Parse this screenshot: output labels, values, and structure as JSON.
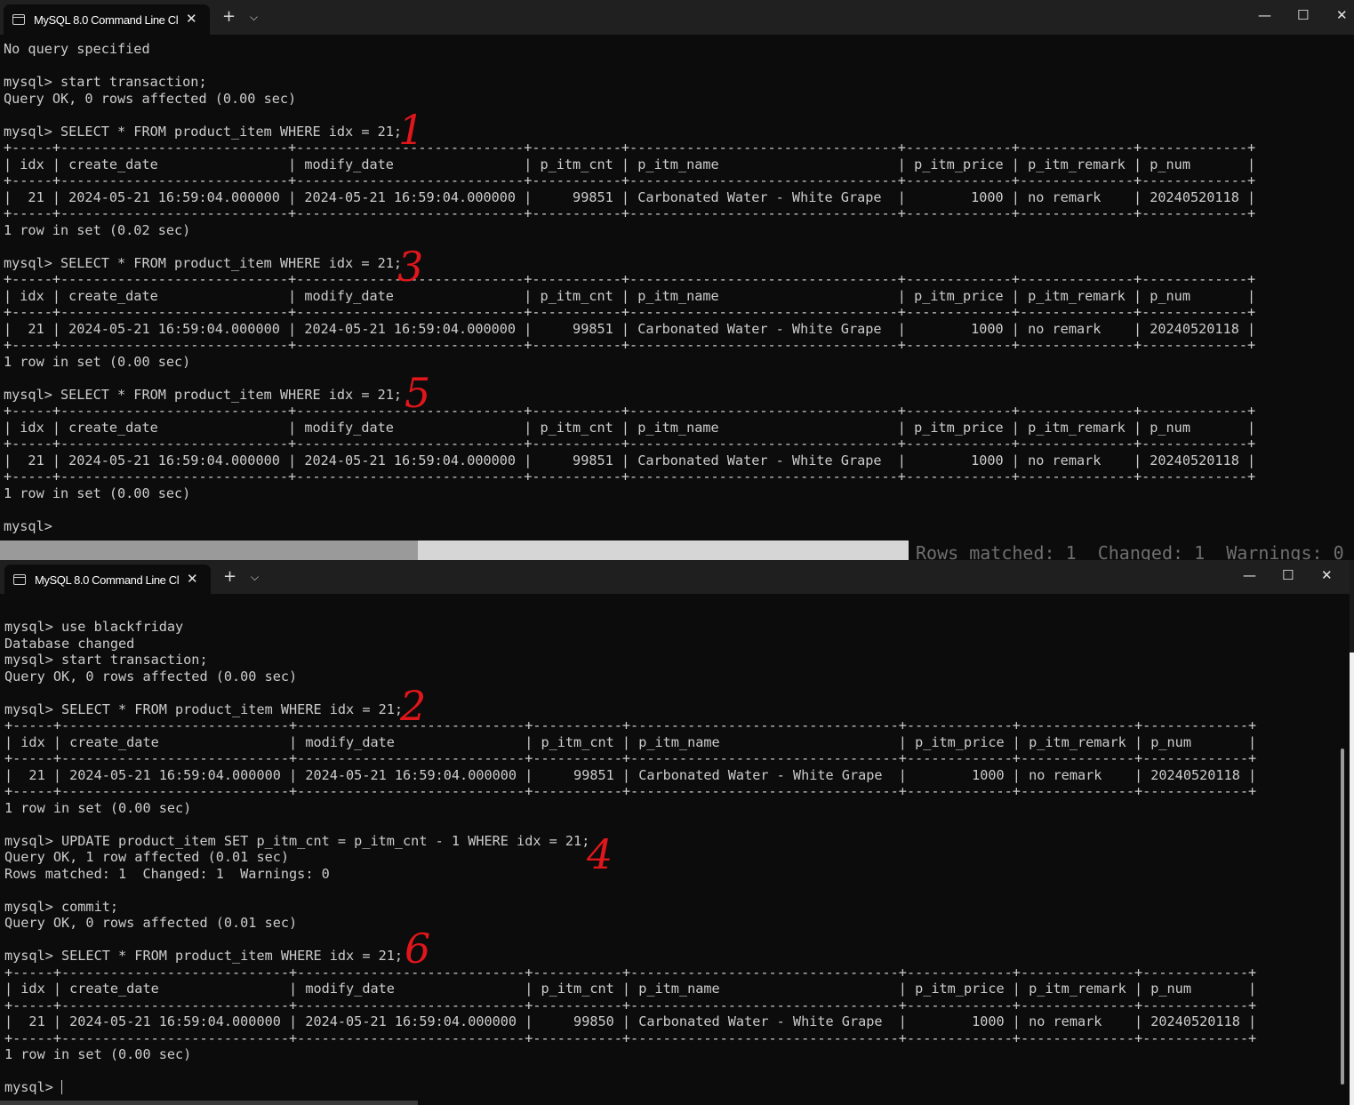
{
  "top_window": {
    "tab_title": "MySQL 8.0 Command Line Client",
    "tab_close": "✕",
    "new_tab": "+",
    "dropdown": "⌵",
    "minimize": "—",
    "maximize": "☐",
    "close": "✕",
    "console_text": "No query specified\n\nmysql> start transaction;\nQuery OK, 0 rows affected (0.00 sec)\n\nmysql> SELECT * FROM product_item WHERE idx = 21;\n+-----+----------------------------+----------------------------+-----------+---------------------------------+-------------+--------------+-------------+\n| idx | create_date                | modify_date                | p_itm_cnt | p_itm_name                      | p_itm_price | p_itm_remark | p_num       |\n+-----+----------------------------+----------------------------+-----------+---------------------------------+-------------+--------------+-------------+\n|  21 | 2024-05-21 16:59:04.000000 | 2024-05-21 16:59:04.000000 |     99851 | Carbonated Water - White Grape  |        1000 | no remark    | 20240520118 |\n+-----+----------------------------+----------------------------+-----------+---------------------------------+-------------+--------------+-------------+\n1 row in set (0.02 sec)\n\nmysql> SELECT * FROM product_item WHERE idx = 21;\n+-----+----------------------------+----------------------------+-----------+---------------------------------+-------------+--------------+-------------+\n| idx | create_date                | modify_date                | p_itm_cnt | p_itm_name                      | p_itm_price | p_itm_remark | p_num       |\n+-----+----------------------------+----------------------------+-----------+---------------------------------+-------------+--------------+-------------+\n|  21 | 2024-05-21 16:59:04.000000 | 2024-05-21 16:59:04.000000 |     99851 | Carbonated Water - White Grape  |        1000 | no remark    | 20240520118 |\n+-----+----------------------------+----------------------------+-----------+---------------------------------+-------------+--------------+-------------+\n1 row in set (0.00 sec)\n\nmysql> SELECT * FROM product_item WHERE idx = 21;\n+-----+----------------------------+----------------------------+-----------+---------------------------------+-------------+--------------+-------------+\n| idx | create_date                | modify_date                | p_itm_cnt | p_itm_name                      | p_itm_price | p_itm_remark | p_num       |\n+-----+----------------------------+----------------------------+-----------+---------------------------------+-------------+--------------+-------------+\n|  21 | 2024-05-21 16:59:04.000000 | 2024-05-21 16:59:04.000000 |     99851 | Carbonated Water - White Grape  |        1000 | no remark    | 20240520118 |\n+-----+----------------------------+----------------------------+-----------+---------------------------------+-------------+--------------+-------------+\n1 row in set (0.00 sec)\n\nmysql>"
  },
  "ghost_text": "Rows matched: 1  Changed: 1  Warnings: 0",
  "bottom_window": {
    "tab_title": "MySQL 8.0 Command Line Client",
    "tab_close": "✕",
    "new_tab": "+",
    "dropdown": "⌵",
    "minimize": "—",
    "maximize": "☐",
    "close": "✕",
    "console_text": "mysql> use blackfriday\nDatabase changed\nmysql> start transaction;\nQuery OK, 0 rows affected (0.00 sec)\n\nmysql> SELECT * FROM product_item WHERE idx = 21;\n+-----+----------------------------+----------------------------+-----------+---------------------------------+-------------+--------------+-------------+\n| idx | create_date                | modify_date                | p_itm_cnt | p_itm_name                      | p_itm_price | p_itm_remark | p_num       |\n+-----+----------------------------+----------------------------+-----------+---------------------------------+-------------+--------------+-------------+\n|  21 | 2024-05-21 16:59:04.000000 | 2024-05-21 16:59:04.000000 |     99851 | Carbonated Water - White Grape  |        1000 | no remark    | 20240520118 |\n+-----+----------------------------+----------------------------+-----------+---------------------------------+-------------+--------------+-------------+\n1 row in set (0.00 sec)\n\nmysql> UPDATE product_item SET p_itm_cnt = p_itm_cnt - 1 WHERE idx = 21;\nQuery OK, 1 row affected (0.01 sec)\nRows matched: 1  Changed: 1  Warnings: 0\n\nmysql> commit;\nQuery OK, 0 rows affected (0.01 sec)\n\nmysql> SELECT * FROM product_item WHERE idx = 21;\n+-----+----------------------------+----------------------------+-----------+---------------------------------+-------------+--------------+-------------+\n| idx | create_date                | modify_date                | p_itm_cnt | p_itm_name                      | p_itm_price | p_itm_remark | p_num       |\n+-----+----------------------------+----------------------------+-----------+---------------------------------+-------------+--------------+-------------+\n|  21 | 2024-05-21 16:59:04.000000 | 2024-05-21 16:59:04.000000 |     99850 | Carbonated Water - White Grape  |        1000 | no remark    | 20240520118 |\n+-----+----------------------------+----------------------------+-----------+---------------------------------+-------------+--------------+-------------+\n1 row in set (0.00 sec)\n\n",
    "prompt": "mysql> "
  },
  "annotations": {
    "step_1": "1",
    "step_2": "2",
    "step_3": "3",
    "step_4": "4",
    "step_5": "5",
    "step_6": "6",
    "color": "#e0161b"
  }
}
